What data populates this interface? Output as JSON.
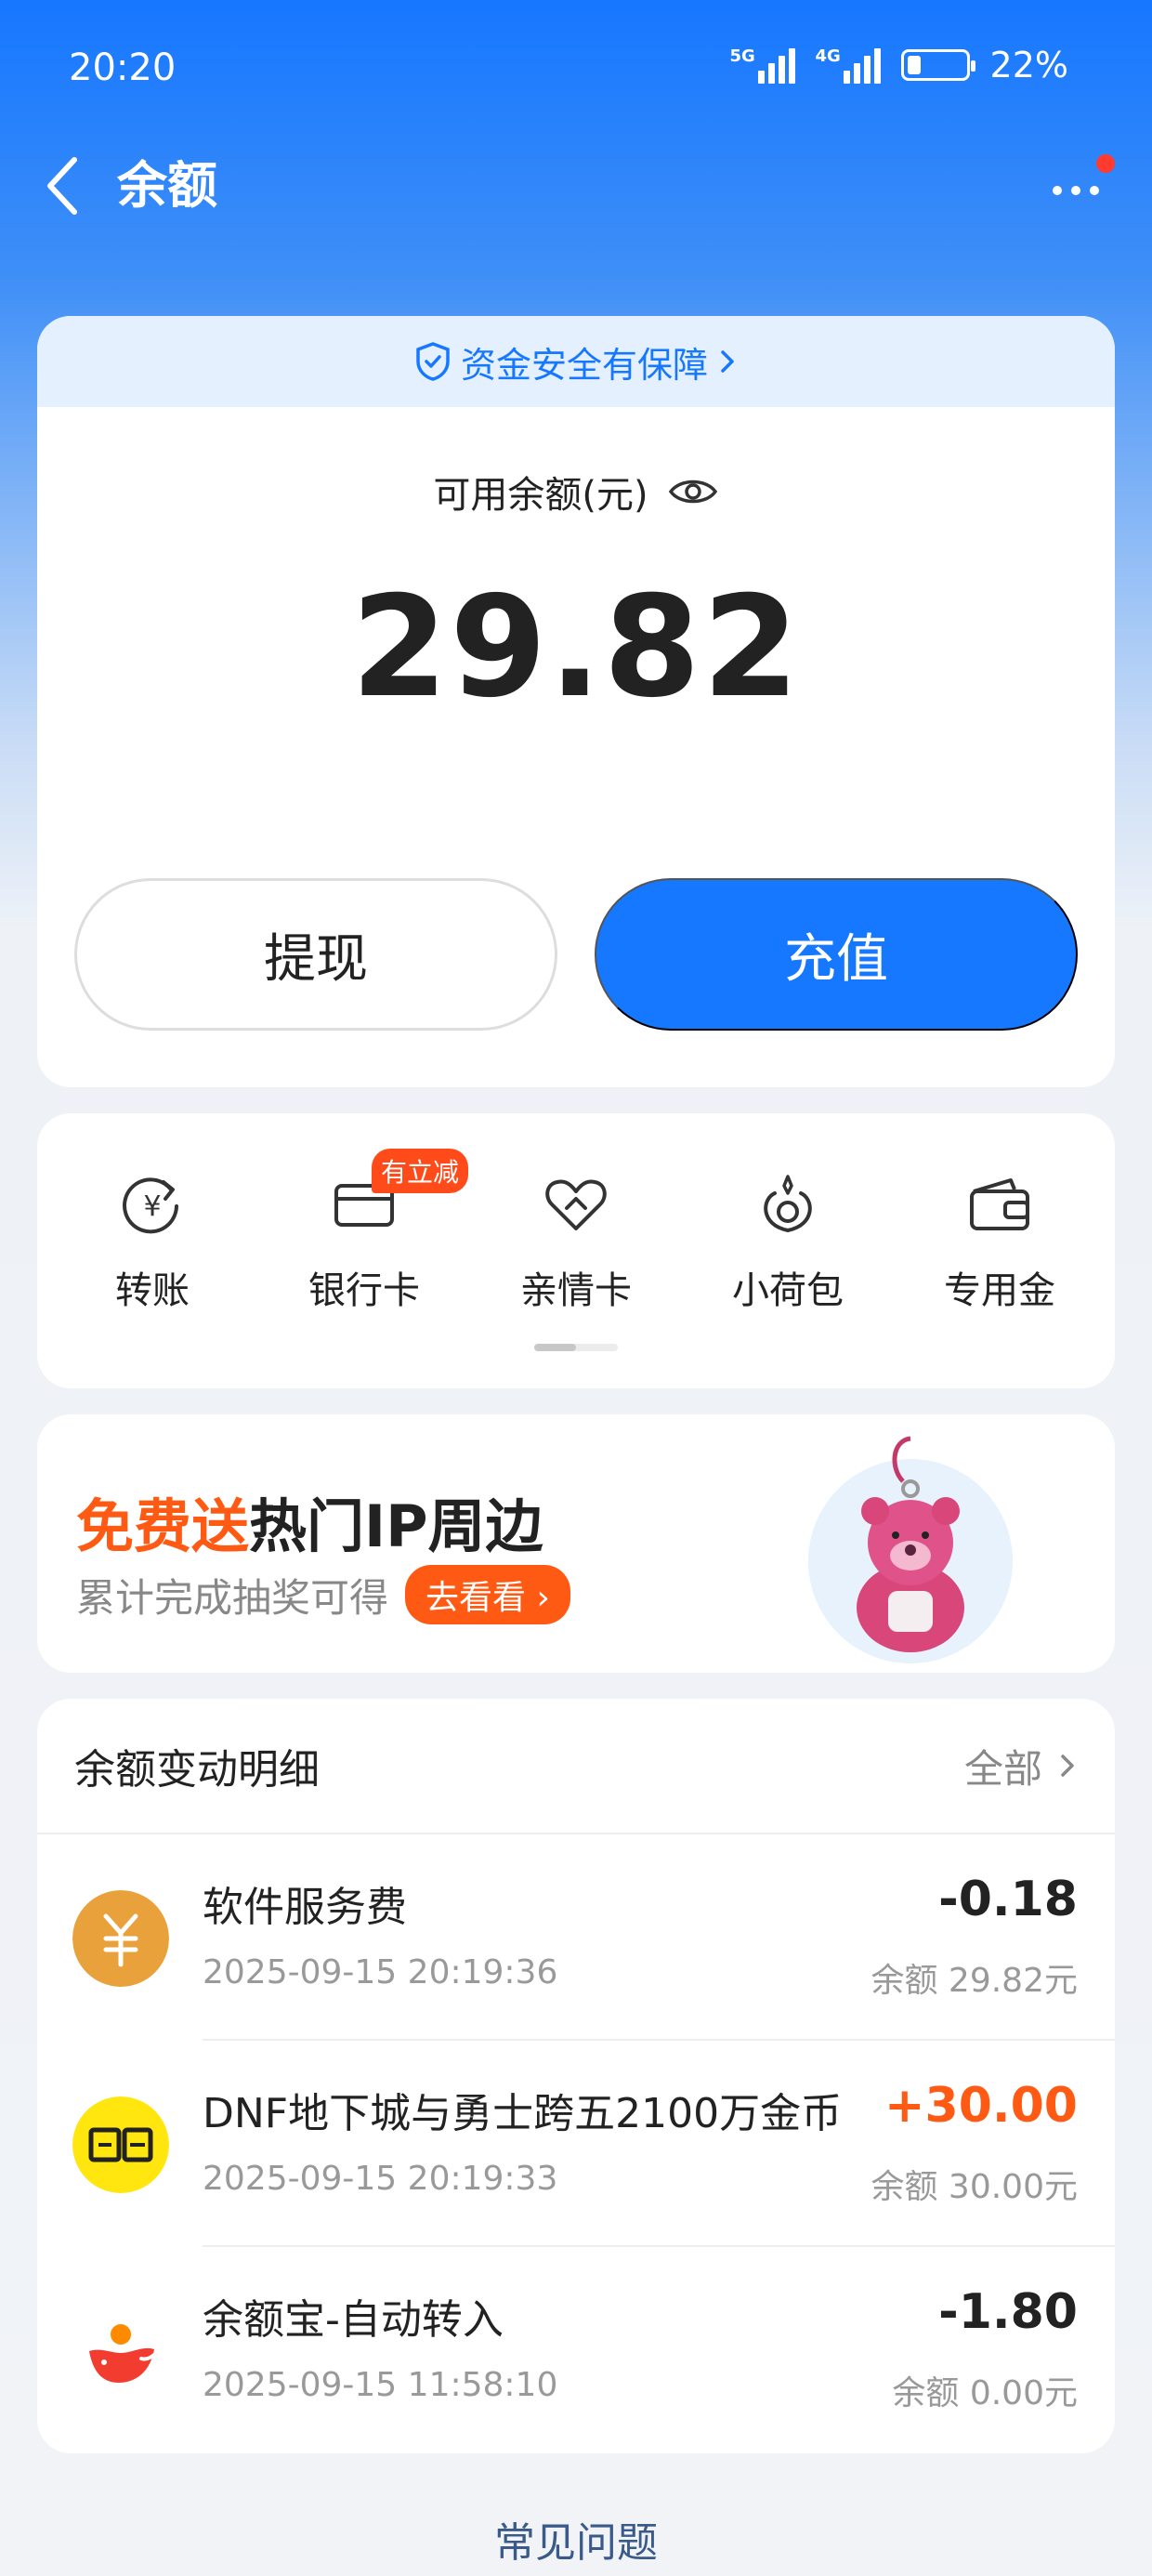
{
  "status_bar": {
    "time": "20:20",
    "net1": "5G",
    "net2": "4G",
    "battery": "22%",
    "battery_level": 0.22
  },
  "nav": {
    "title": "余额",
    "back_icon": "chevron-left-icon",
    "more_icon": "more-dots-icon"
  },
  "balance": {
    "safety_text": "资金安全有保障",
    "label": "可用余额(元)",
    "amount": "29.82",
    "withdraw_label": "提现",
    "recharge_label": "充值"
  },
  "actions": [
    {
      "label": "转账",
      "icon": "transfer-icon"
    },
    {
      "label": "银行卡",
      "icon": "bank-card-icon",
      "badge": "有立减"
    },
    {
      "label": "亲情卡",
      "icon": "family-card-icon"
    },
    {
      "label": "小荷包",
      "icon": "pouch-icon"
    },
    {
      "label": "专用金",
      "icon": "wallet-icon"
    }
  ],
  "promo": {
    "title_highlight": "免费送",
    "title_rest": "热门IP周边",
    "subtitle": "累计完成抽奖可得",
    "cta": "去看看"
  },
  "details": {
    "title": "余额变动明细",
    "all_label": "全部",
    "transactions": [
      {
        "name": "软件服务费",
        "time": "2025-09-15 20:19:36",
        "amount": "-0.18",
        "balance": "余额 29.82元",
        "icon": "yuan-coin-icon"
      },
      {
        "name": "DNF地下城与勇士跨五2100万金币",
        "time": "2025-09-15 20:19:33",
        "amount": "+30.00",
        "balance": "余额 30.00元",
        "icon": "xianyu-logo-icon"
      },
      {
        "name": "余额宝-自动转入",
        "time": "2025-09-15 11:58:10",
        "amount": "-1.80",
        "balance": "余额 0.00元",
        "icon": "yuebao-logo-icon"
      }
    ]
  },
  "faq": "常见问题",
  "colors": {
    "brand_blue": "#1677ff",
    "accent_orange": "#ff5a14"
  }
}
